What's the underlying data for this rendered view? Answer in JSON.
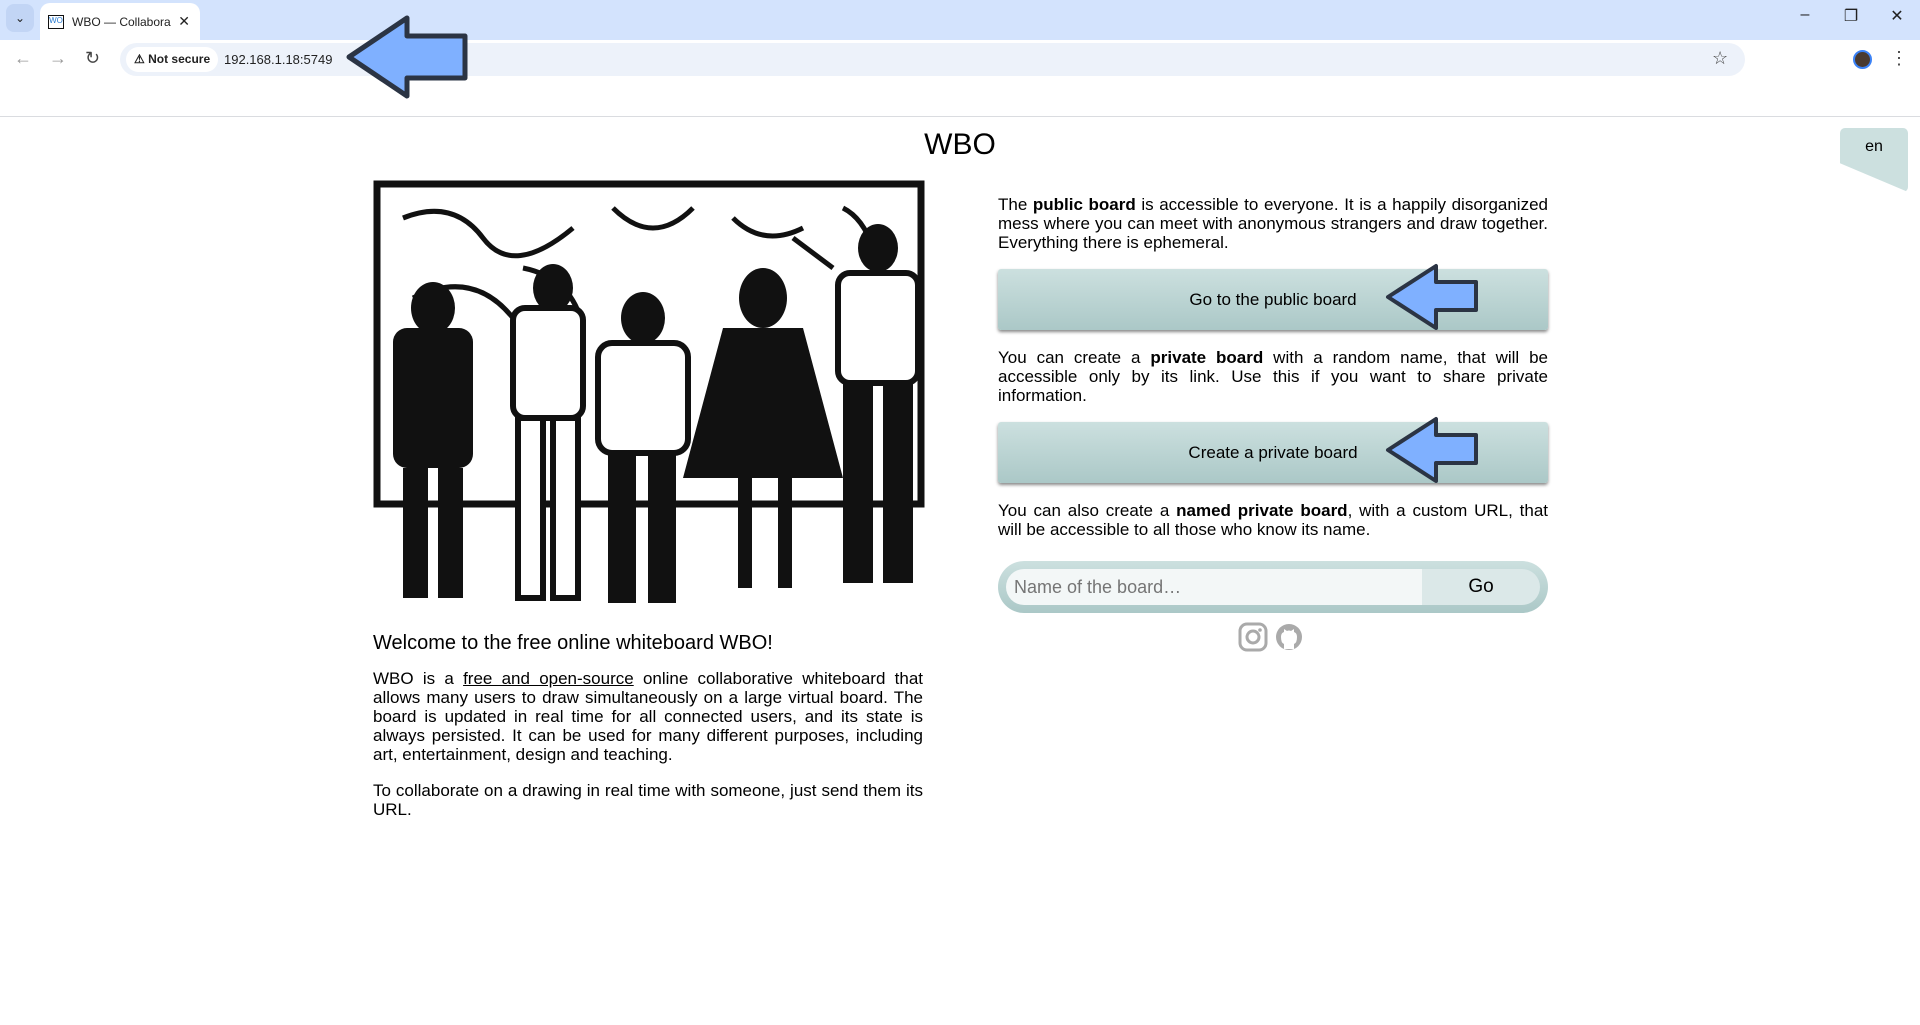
{
  "browser": {
    "tab_title": "WBO — Collabora",
    "url": "192.168.1.18:5749",
    "security_label": "Not secure"
  },
  "page": {
    "title": "WBO",
    "language": "en",
    "welcome_heading": "Welcome to the free online whiteboard WBO!",
    "intro_prefix": "WBO is a ",
    "intro_link": "free and open-source",
    "intro_suffix": " online collaborative whiteboard that allows many users to draw simultaneously on a large virtual board. The board is updated in real time for all connected users, and its state is always persisted. It can be used for many different purposes, including art, entertainment, design and teaching.",
    "collab_text": "To collaborate on a drawing in real time with someone, just send them its URL.",
    "public_text": {
      "pre": "The ",
      "bold": "public board",
      "post": " is accessible to everyone. It is a happily disorganized mess where you can meet with anonymous strangers and draw together. Everything there is ephemeral."
    },
    "public_button": "Go to the public board",
    "private_text": {
      "pre": "You can create a ",
      "bold": "private board",
      "post": " with a random name, that will be accessible only by its link. Use this if you want to share private information."
    },
    "private_button": "Create a private board",
    "named_text": {
      "pre": "You can also create a ",
      "bold": "named private board",
      "post": ", with a custom URL, that will be accessible to all those who know its name."
    },
    "board_name_placeholder": "Name of the board…",
    "board_name_value": "",
    "go_button": "Go"
  },
  "colors": {
    "button": "#cce0df",
    "annotation_arrow": "#7fb0ff"
  }
}
